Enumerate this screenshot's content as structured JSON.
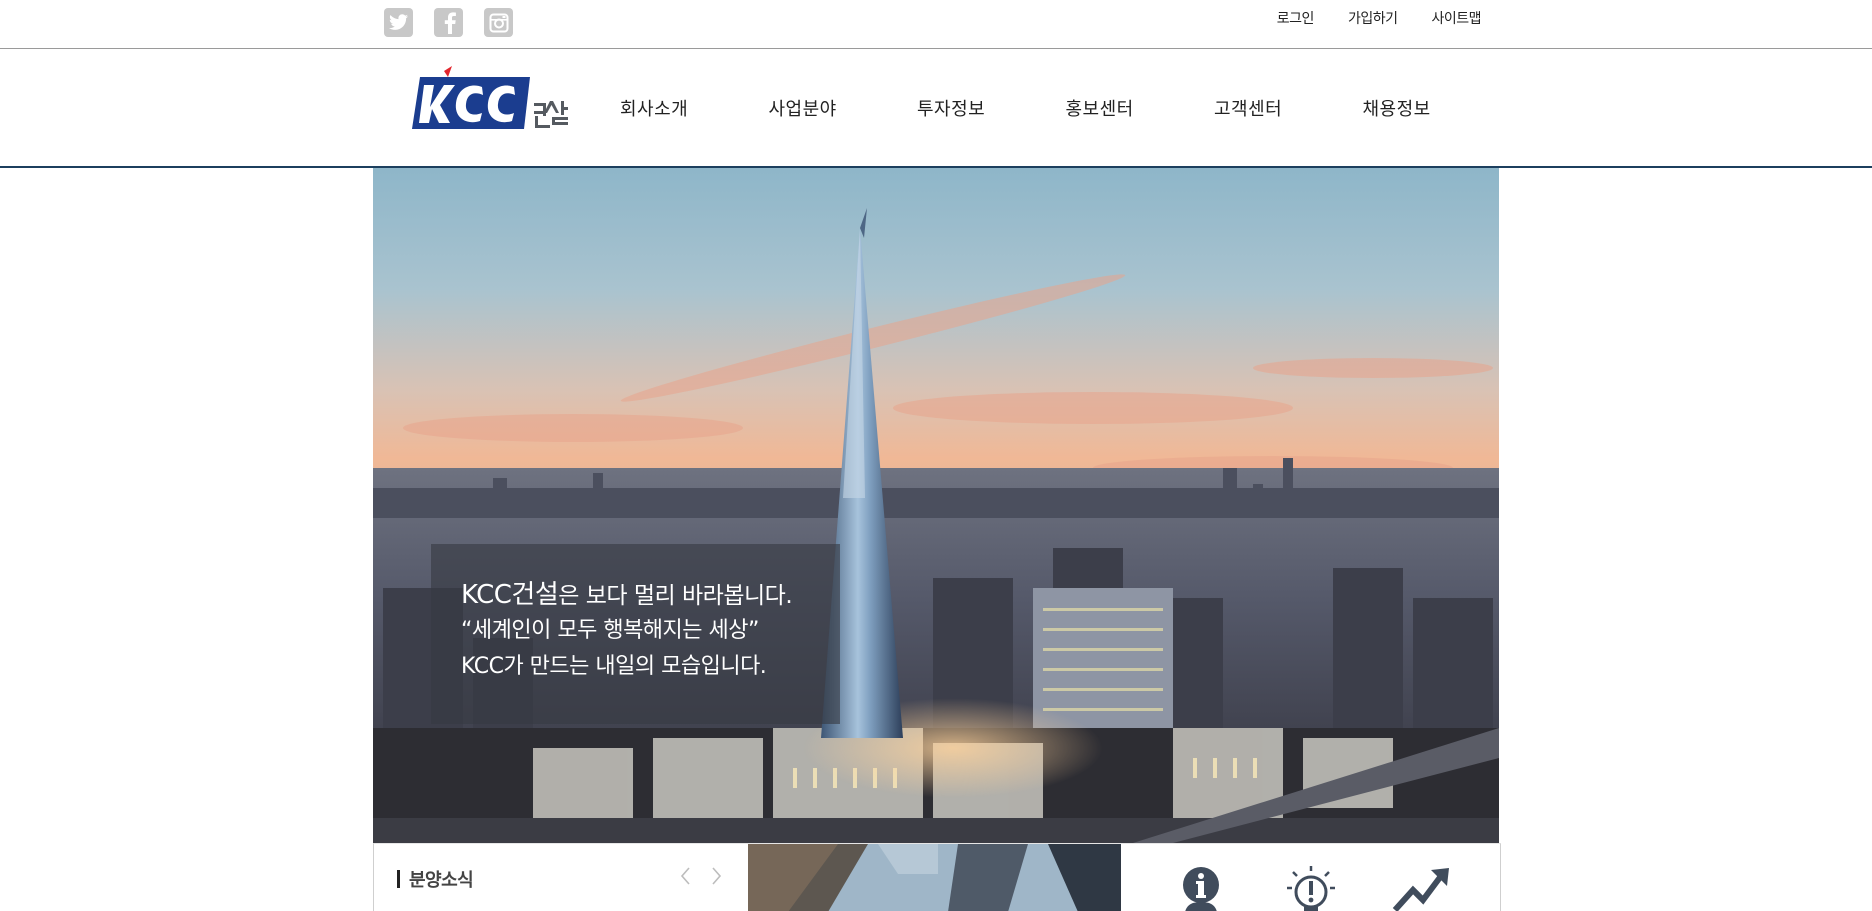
{
  "topbar": {
    "social": [
      {
        "name": "twitter-icon"
      },
      {
        "name": "facebook-icon"
      },
      {
        "name": "instagram-icon"
      }
    ],
    "util_links": {
      "login": "로그인",
      "signup": "가입하기",
      "sitemap": "사이트맵"
    }
  },
  "header": {
    "logo": {
      "brand": "KCC",
      "suffix": "건설",
      "brand_color": "#1b3d8f",
      "accent_color": "#e3262d"
    },
    "nav": [
      {
        "label": "회사소개"
      },
      {
        "label": "사업분야"
      },
      {
        "label": "투자정보"
      },
      {
        "label": "홍보센터"
      },
      {
        "label": "고객센터"
      },
      {
        "label": "채용정보"
      }
    ],
    "border_color": "#1c3f5e"
  },
  "hero": {
    "caption": {
      "brand": "KCC건설",
      "line1_rest": "은 보다 멀리 바라봅니다.",
      "line2": "“세계인이 모두 행복해지는 세상”",
      "line3": "KCC가 만드는 내일의 모습입니다."
    }
  },
  "bottom": {
    "news": {
      "title": "분양소식"
    },
    "icons": [
      {
        "name": "info-person-icon"
      },
      {
        "name": "alert-lightbulb-icon"
      },
      {
        "name": "growth-chart-icon"
      }
    ]
  }
}
